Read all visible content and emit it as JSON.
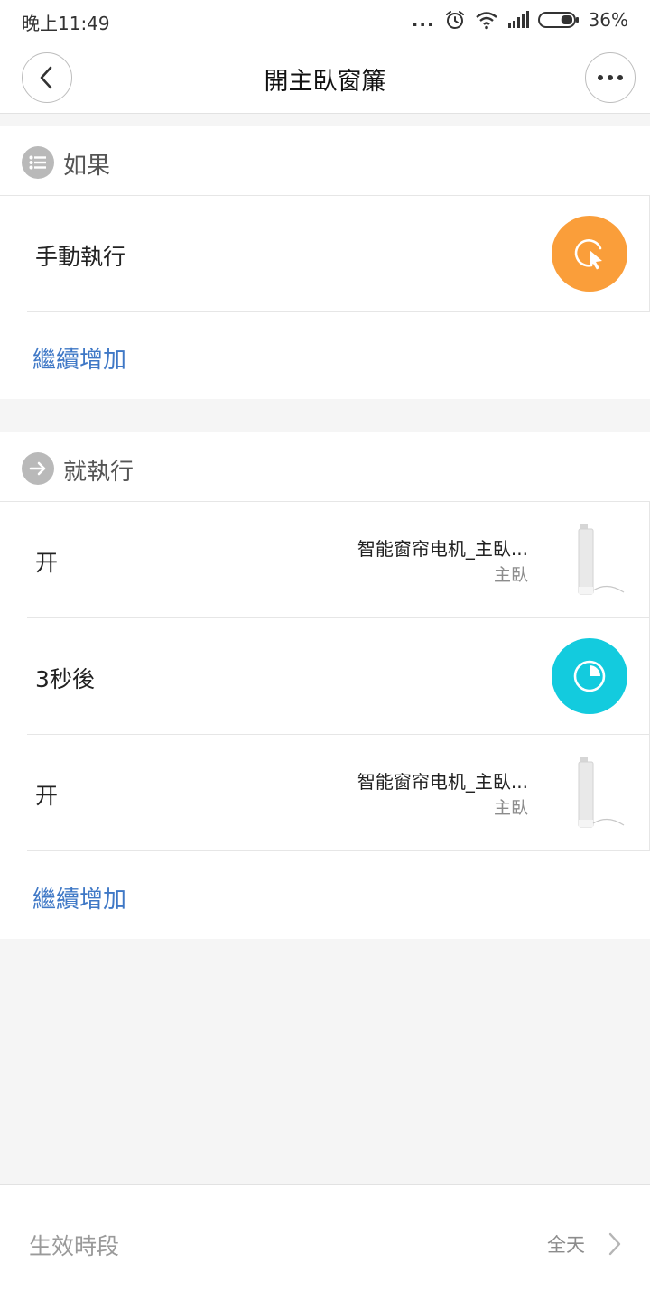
{
  "status_bar": {
    "time": "晚上11:49",
    "dots": "...",
    "battery_percent": "36%",
    "battery_level": 0.36,
    "icons": [
      "alarm-icon",
      "wifi-icon",
      "signal-icon",
      "battery-icon"
    ]
  },
  "header": {
    "title": "開主臥窗簾",
    "back_icon": "chevron-left-icon",
    "more_icon": "more-dots-icon"
  },
  "if_section": {
    "label": "如果",
    "icon": "list-icon",
    "conditions": [
      {
        "label": "手動執行",
        "icon": "tap-cursor-icon",
        "color": "#fa9e3a"
      }
    ],
    "add_label": "繼續增加"
  },
  "then_section": {
    "label": "就執行",
    "icon": "arrow-right-icon",
    "actions": [
      {
        "label": "开",
        "device_name": "智能窗帘电机_主臥...",
        "room": "主臥"
      },
      {
        "label": "3秒後",
        "icon": "timer-icon",
        "color": "#13cbde"
      },
      {
        "label": "开",
        "device_name": "智能窗帘电机_主臥...",
        "room": "主臥"
      }
    ],
    "add_label": "繼續增加"
  },
  "bottom": {
    "label": "生效時段",
    "value": "全天",
    "icon": "chevron-right-icon"
  }
}
